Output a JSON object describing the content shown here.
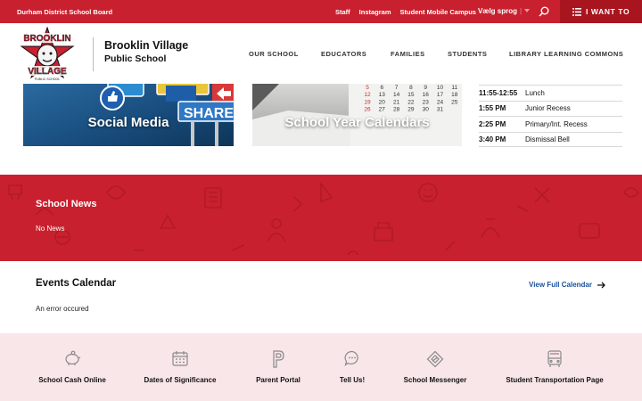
{
  "topbar": {
    "board_name": "Durham District School Board",
    "links": [
      "Staff",
      "Instagram",
      "Student Mobile Campus"
    ],
    "language_label": "Vælg sprog",
    "i_want_to": "I WANT TO"
  },
  "header": {
    "school_name": "Brooklin Village",
    "school_subtitle": "Public School",
    "logo_text_top": "BROOKLIN",
    "logo_text_bottom": "VILLAGE",
    "logo_text_small": "PUBLIC SCHOOL",
    "nav": [
      "OUR SCHOOL",
      "EDUCATORS",
      "FAMILIES",
      "STUDENTS",
      "LIBRARY LEARNING COMMONS"
    ]
  },
  "tiles": [
    {
      "label": "Social Media",
      "sign_text": "SHARE"
    },
    {
      "label": "School Year Calendars"
    }
  ],
  "calendar_numbers": [
    "5",
    "6",
    "7",
    "8",
    "9",
    "10",
    "11",
    "12",
    "13",
    "14",
    "15",
    "16",
    "17",
    "18",
    "19",
    "20",
    "21",
    "22",
    "23",
    "24",
    "25",
    "26",
    "27",
    "28",
    "29",
    "30",
    "31"
  ],
  "schedule": [
    {
      "time": "11:55-12:55",
      "label": "Lunch"
    },
    {
      "time": "1:55 PM",
      "label": "Junior Recess"
    },
    {
      "time": "2:25 PM",
      "label": "Primary/Int. Recess"
    },
    {
      "time": "3:40 PM",
      "label": "Dismissal Bell"
    }
  ],
  "news": {
    "title": "School News",
    "empty": "No News"
  },
  "events": {
    "title": "Events Calendar",
    "link": "View Full Calendar",
    "error": "An error occured"
  },
  "quick_links": [
    {
      "label": "School Cash Online",
      "icon": "piggy-bank-icon"
    },
    {
      "label": "Dates of Significance",
      "icon": "calendar-icon"
    },
    {
      "label": "Parent Portal",
      "icon": "portal-p-icon"
    },
    {
      "label": "Tell Us!",
      "icon": "speech-bubble-icon"
    },
    {
      "label": "School Messenger",
      "icon": "messenger-icon"
    },
    {
      "label": "Student Transportation Page",
      "icon": "bus-icon"
    }
  ],
  "colors": {
    "brand_red": "#c8202e",
    "dark_red": "#a8151f",
    "link_blue": "#1b4f9a",
    "quick_bg": "#f9e6e8"
  }
}
